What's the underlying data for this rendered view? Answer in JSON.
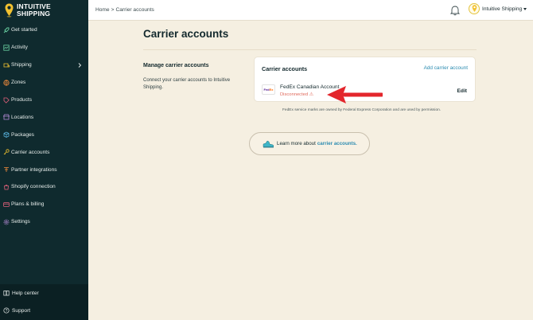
{
  "app": {
    "brand_line1": "INTUITIVE",
    "brand_line2": "SHIPPING"
  },
  "colors": {
    "sidebar": "#0f2a2e",
    "background": "#f5efe1",
    "accent": "#2b8bb0",
    "brand_yellow": "#f2c230",
    "error": "#e06a5c"
  },
  "sidebar": {
    "items": [
      {
        "label": "Get started",
        "icon": "rocket-icon"
      },
      {
        "label": "Activity",
        "icon": "activity-icon"
      },
      {
        "label": "Shipping",
        "icon": "shipping-icon",
        "has_chevron": true
      },
      {
        "label": "Zones",
        "icon": "globe-icon"
      },
      {
        "label": "Products",
        "icon": "tag-icon"
      },
      {
        "label": "Locations",
        "icon": "store-icon"
      },
      {
        "label": "Packages",
        "icon": "box-icon"
      },
      {
        "label": "Carrier accounts",
        "icon": "key-icon"
      },
      {
        "label": "Partner integrations",
        "icon": "plug-icon"
      },
      {
        "label": "Shopify connection",
        "icon": "shopify-icon"
      },
      {
        "label": "Plans & billing",
        "icon": "card-icon"
      },
      {
        "label": "Settings",
        "icon": "gear-icon"
      }
    ],
    "footer": [
      {
        "label": "Help center",
        "icon": "book-icon"
      },
      {
        "label": "Support",
        "icon": "help-icon"
      }
    ]
  },
  "topbar": {
    "breadcrumb_home": "Home",
    "breadcrumb_sep": ">",
    "breadcrumb_current": "Carrier accounts",
    "account_name": "Intuitive Shipping"
  },
  "main": {
    "title": "Carrier accounts",
    "section_heading": "Manage carrier accounts",
    "section_desc": "Connect your carrier accounts to Intuitive Shipping.",
    "card": {
      "title": "Carrier accounts",
      "add_label": "Add carrier account",
      "account_name": "FedEx Canadian Account",
      "account_status": "Disconnected",
      "status_symbol": "⚠",
      "edit_label": "Edit",
      "logo_fed": "Fed",
      "logo_ex": "Ex"
    },
    "fedex_note": "FedEx service marks are owned by Federal Express Corporation and are used by permission.",
    "learn_prefix": "Learn more about",
    "learn_link": "carrier accounts."
  }
}
